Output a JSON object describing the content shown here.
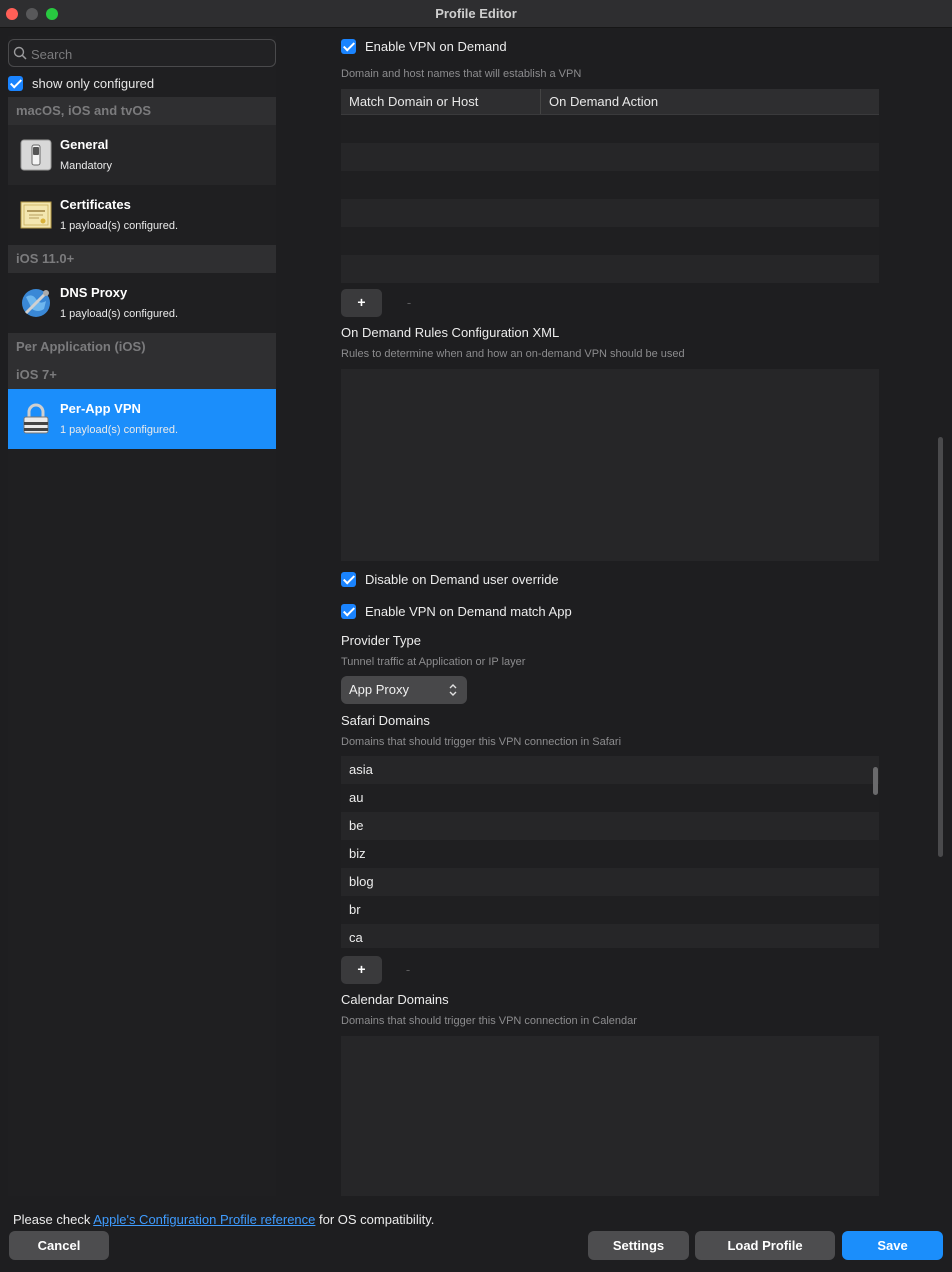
{
  "window": {
    "title": "Profile Editor"
  },
  "sidebar": {
    "search_placeholder": "Search",
    "show_only_configured": "show only configured",
    "sections": [
      {
        "title": "macOS, iOS and tvOS"
      },
      {
        "title": "iOS 11.0+"
      },
      {
        "title": "Per Application (iOS)"
      },
      {
        "title": "iOS 7+"
      }
    ],
    "items": [
      {
        "name": "General",
        "sub": "Mandatory",
        "icon": "switch-icon"
      },
      {
        "name": "Certificates",
        "sub": "1 payload(s) configured.",
        "icon": "certificate-icon"
      },
      {
        "name": "DNS Proxy",
        "sub": "1 payload(s) configured.",
        "icon": "globe-icon"
      },
      {
        "name": "Per-App VPN",
        "sub": "1 payload(s) configured.",
        "icon": "lock-icon",
        "selected": true
      }
    ]
  },
  "main": {
    "enable_vpn_on_demand": "Enable VPN on Demand",
    "on_demand_hint": "Domain and host names that will establish a VPN",
    "table_headers": [
      "Match Domain or Host",
      "On Demand Action"
    ],
    "add_label": "+",
    "remove_label": "-",
    "rules_xml_label": "On Demand Rules Configuration XML",
    "rules_xml_hint": "Rules to determine when and how an on-demand VPN should be used",
    "disable_override": "Disable on Demand user override",
    "enable_match_app": "Enable VPN on Demand match App",
    "provider_type_label": "Provider Type",
    "provider_type_hint": "Tunnel traffic at Application or IP layer",
    "provider_type_value": "App Proxy",
    "safari_domains_label": "Safari Domains",
    "safari_domains_hint": "Domains that should trigger this VPN connection in Safari",
    "safari_domains": [
      "asia",
      "au",
      "be",
      "biz",
      "blog",
      "br",
      "ca"
    ],
    "calendar_domains_label": "Calendar Domains",
    "calendar_domains_hint": "Domains that should trigger this VPN connection in Calendar"
  },
  "footer": {
    "note_prefix": "Please check ",
    "note_link": "Apple's Configuration Profile reference",
    "note_suffix": " for OS compatibility.",
    "cancel": "Cancel",
    "settings": "Settings",
    "load_profile": "Load Profile",
    "save": "Save"
  },
  "colors": {
    "accent": "#1b8efb",
    "window_bg": "#1e1e20"
  }
}
